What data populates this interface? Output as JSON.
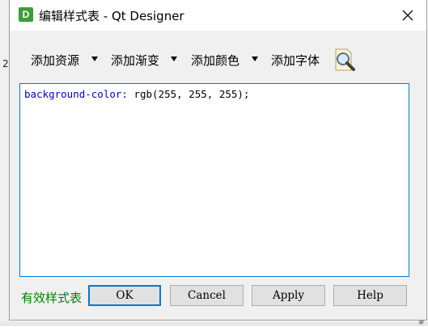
{
  "window": {
    "title": "编辑样式表 - Qt Designer",
    "app_icon_letter": "D"
  },
  "toolbar": {
    "add_resource": "添加资源",
    "add_gradient": "添加渐变",
    "add_color": "添加颜色",
    "add_font": "添加字体"
  },
  "editor": {
    "property": "background-color:",
    "value": " rgb(255, 255, 255);"
  },
  "status": {
    "text": "有效样式表",
    "color": "#008000"
  },
  "buttons": {
    "ok": "OK",
    "cancel": "Cancel",
    "apply": "Apply",
    "help": "Help"
  },
  "background": {
    "left_tick": "2",
    "bottom_label": "#"
  },
  "colors": {
    "accent": "#0078d7",
    "app_icon": "#3f9b3a",
    "property_text": "#0000c8"
  }
}
